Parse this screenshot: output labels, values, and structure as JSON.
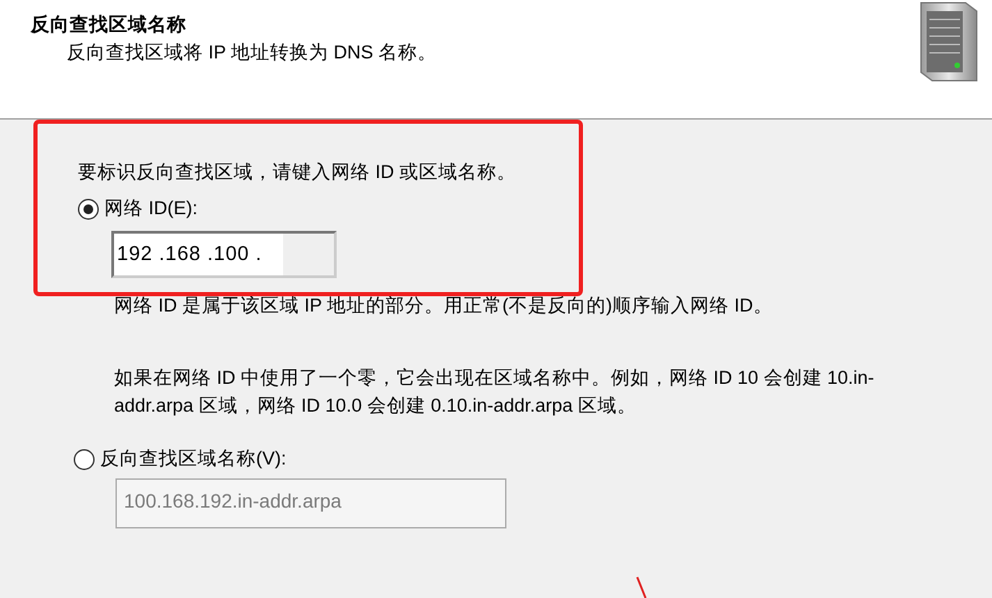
{
  "header": {
    "title": "反向查找区域名称",
    "subtitle": "反向查找区域将 IP 地址转换为 DNS 名称。"
  },
  "body": {
    "instruction": "要标识反向查找区域，请键入网络 ID 或区域名称。",
    "options": [
      {
        "kind": "ip",
        "label": "网络 ID(E):",
        "selected": true,
        "value": "192 .168 .100 .",
        "disabled": false,
        "notes": [
          "网络 ID 是属于该区域 IP 地址的部分。用正常(不是反向的)顺序输入网络 ID。",
          "如果在网络 ID 中使用了一个零，它会出现在区域名称中。例如，网络 ID 10 会创建 10.in-addr.arpa 区域，网络 ID 10.0 会创建 0.10.in-addr.arpa 区域。"
        ]
      },
      {
        "kind": "name",
        "label": "反向查找区域名称(V):",
        "selected": false,
        "value": "100.168.192.in-addr.arpa",
        "disabled": true
      }
    ]
  }
}
